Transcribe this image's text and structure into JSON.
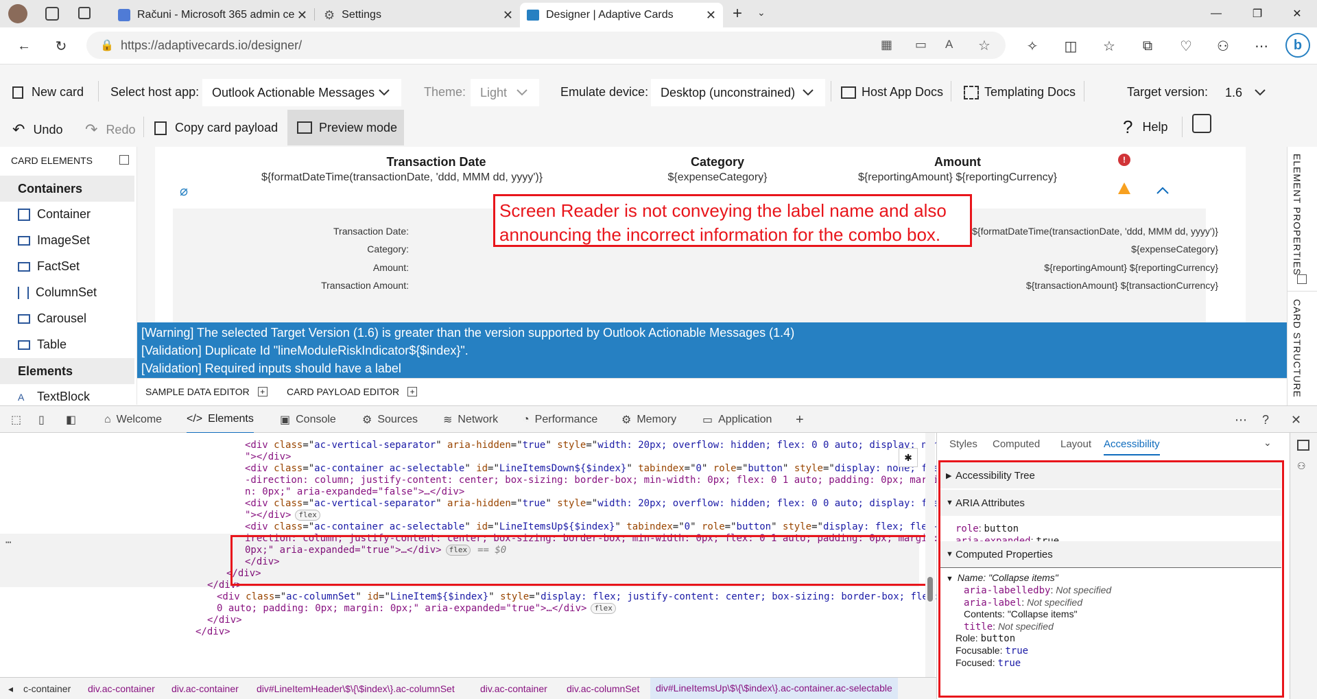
{
  "browser": {
    "tabs": [
      {
        "label": "Računi - Microsoft 365 admin ce"
      },
      {
        "label": "Settings"
      },
      {
        "label": "Designer | Adaptive Cards"
      }
    ],
    "url": "https://adaptivecards.io/designer/"
  },
  "toolbar": {
    "new_card": "New card",
    "select_host_label": "Select host app:",
    "host_app_value": "Outlook Actionable Messages",
    "theme_label": "Theme:",
    "theme_value": "Light",
    "emulate_label": "Emulate device:",
    "emulate_value": "Desktop (unconstrained)",
    "host_app_docs": "Host App Docs",
    "templating_docs": "Templating Docs",
    "target_version_label": "Target version:",
    "target_version_value": "1.6",
    "undo": "Undo",
    "redo": "Redo",
    "copy_payload": "Copy card payload",
    "preview_mode": "Preview mode",
    "help": "Help"
  },
  "palette": {
    "title": "CARD ELEMENTS",
    "containers_header": "Containers",
    "containers": [
      "Container",
      "ImageSet",
      "FactSet",
      "ColumnSet",
      "Carousel",
      "Table"
    ],
    "elements_header": "Elements",
    "elements": [
      "TextBlock"
    ]
  },
  "card": {
    "headers": [
      "Transaction Date",
      "Category",
      "Amount"
    ],
    "templates": [
      "${formatDateTime(transactionDate, 'ddd, MMM dd, yyyy')}",
      "${expenseCategory}",
      "${reportingAmount} ${reportingCurrency}"
    ],
    "facts": [
      {
        "label": "Transaction Date:",
        "value": "${formatDateTime(transactionDate, 'ddd, MMM dd, yyyy')}"
      },
      {
        "label": "Category:",
        "value": "${expenseCategory}"
      },
      {
        "label": "Amount:",
        "value": "${reportingAmount} ${reportingCurrency}"
      },
      {
        "label": "Transaction Amount:",
        "value": "${transactionAmount} ${transactionCurrency}"
      }
    ]
  },
  "annotation": "Screen Reader is not conveying the label name and also announcing the incorrect information for the combo box.",
  "warnings": [
    "[Warning] The selected Target Version (1.6) is greater than the version supported by Outlook Actionable Messages (1.4)",
    "[Validation] Duplicate Id \"lineModuleRiskIndicator${$index}\".",
    "[Validation] Required inputs should have a label"
  ],
  "editors": {
    "sample_data": "SAMPLE DATA EDITOR",
    "card_payload": "CARD PAYLOAD EDITOR"
  },
  "side_tabs": {
    "element_properties": "ELEMENT PROPERTIES",
    "card_structure": "CARD STRUCTURE"
  },
  "devtools": {
    "tabs": [
      "Welcome",
      "Elements",
      "Console",
      "Sources",
      "Network",
      "Performance",
      "Memory",
      "Application"
    ],
    "dom_lines": [
      {
        "indent": 357,
        "tag": "<div ",
        "attrs": [
          [
            "class",
            "ac-vertical-separator"
          ],
          [
            "aria-hidden",
            "true"
          ],
          [
            "style",
            "width: 20px; overflow: hidden; flex: 0 0 auto; display: non"
          ]
        ],
        "tail": ""
      },
      {
        "indent": 357,
        "text": "\"></div>"
      },
      {
        "indent": 357,
        "tag": "<div ",
        "attrs": [
          [
            "class",
            "ac-container ac-selectable"
          ],
          [
            "id",
            "LineItemsDown${$index}"
          ],
          [
            "tabindex",
            "0"
          ],
          [
            "role",
            "button"
          ],
          [
            "style",
            "display: none; fle"
          ]
        ],
        "tail": ""
      },
      {
        "indent": 357,
        "text": "-direction: column; justify-content: center; box-sizing: border-box; min-width: 0px; flex: 0 1 auto; padding: 0px; margi"
      },
      {
        "indent": 357,
        "text": "n: 0px;\" aria-expanded=\"false\">…</div>"
      },
      {
        "indent": 357,
        "tag": "<div ",
        "attrs": [
          [
            "class",
            "ac-vertical-separator"
          ],
          [
            "aria-hidden",
            "true"
          ],
          [
            "style",
            "width: 20px; overflow: hidden; flex: 0 0 auto; display: fle"
          ]
        ],
        "tail": ""
      },
      {
        "indent": 357,
        "text": "\"></div>",
        "pill": "flex"
      },
      {
        "indent": 357,
        "tag": "<div ",
        "attrs": [
          [
            "class",
            "ac-container ac-selectable"
          ],
          [
            "id",
            "LineItemsUp${$index}"
          ],
          [
            "tabindex",
            "0"
          ],
          [
            "role",
            "button"
          ],
          [
            "style",
            "display: flex; flex-"
          ]
        ],
        "tail": ""
      },
      {
        "indent": 357,
        "text": "irection: column; justify-content: center; box-sizing: border-box; min-width: 0px; flex: 0 1 auto; padding: 0px; margin:"
      },
      {
        "indent": 357,
        "text": "0px;\" aria-expanded=\"true\">…</div>",
        "pill": "flex",
        "suffix": "== $0"
      },
      {
        "indent": 357,
        "text": "</div>"
      },
      {
        "indent": 330,
        "text": "</div>"
      },
      {
        "indent": 302,
        "text": "</div>"
      },
      {
        "indent": 316,
        "tag": "<div ",
        "attrs": [
          [
            "class",
            "ac-columnSet"
          ],
          [
            "id",
            "LineItem${$index}"
          ],
          [
            "style",
            "display: flex; justify-content: center; box-sizing: border-box; flex:"
          ]
        ],
        "tail": ""
      },
      {
        "indent": 316,
        "text": "0 auto; padding: 0px; margin: 0px;\" aria-expanded=\"true\">…</div>",
        "pill": "flex"
      },
      {
        "indent": 302,
        "text": "</div>"
      },
      {
        "indent": 285,
        "text": "</div>"
      }
    ],
    "breadcrumbs": [
      "c-container",
      "div.ac-container",
      "div.ac-container",
      "div#LineItemHeader\\$\\{\\$index\\}.ac-columnSet",
      "div.ac-container",
      "div.ac-columnSet",
      "div#LineItemsUp\\$\\{\\$index\\}.ac-container.ac-selectable"
    ],
    "side_tabs": [
      "Styles",
      "Computed",
      "Layout",
      "Accessibility"
    ],
    "accessibility": {
      "tree": "Accessibility Tree",
      "aria": "ARIA Attributes",
      "aria_attrs": [
        {
          "k": "role",
          "v": "button"
        },
        {
          "k": "aria-expanded",
          "v": "true"
        }
      ],
      "computed": "Computed Properties",
      "name": "Name: \"Collapse items\"",
      "labelledby_k": "aria-labelledby",
      "labelledby_v": "Not specified",
      "label_k": "aria-label",
      "label_v": "Not specified",
      "contents": "Contents: \"Collapse items\"",
      "title_k": "title",
      "title_v": "Not specified",
      "role": "Role:",
      "role_v": "button",
      "focusable": "Focusable:",
      "focusable_v": "true",
      "focused": "Focused:",
      "focused_v": "true"
    }
  },
  "colors": {
    "warning_bar": "#2680c2",
    "annotation": "#e8151b",
    "accent": "#0f6cbd"
  }
}
